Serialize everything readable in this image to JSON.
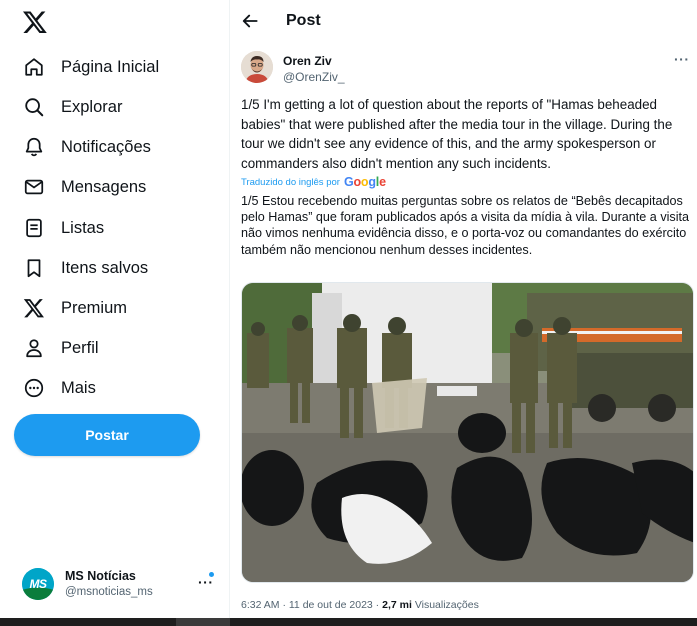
{
  "sidebar": {
    "logo_icon": "x-logo-icon",
    "nav": [
      {
        "label": "Página Inicial",
        "icon": "home-icon"
      },
      {
        "label": "Explorar",
        "icon": "search-icon"
      },
      {
        "label": "Notificações",
        "icon": "bell-icon"
      },
      {
        "label": "Mensagens",
        "icon": "mail-icon"
      },
      {
        "label": "Listas",
        "icon": "list-icon"
      },
      {
        "label": "Itens salvos",
        "icon": "bookmark-icon"
      },
      {
        "label": "Premium",
        "icon": "x-premium-icon"
      },
      {
        "label": "Perfil",
        "icon": "person-icon"
      },
      {
        "label": "Mais",
        "icon": "more-circle-icon"
      }
    ],
    "post_button": "Postar",
    "account": {
      "name": "MS Notícias",
      "handle": "@msnoticias_ms",
      "avatar_text": "MS",
      "more": "···"
    }
  },
  "header": {
    "title": "Post",
    "back_icon": "arrow-left-icon"
  },
  "tweet": {
    "author_name": "Oren Ziv",
    "author_handle": "@OrenZiv_",
    "more": "···",
    "text": "1/5 I'm getting a lot of question about the reports of \"Hamas beheaded babies\" that were published after the media tour in the village. During the tour we didn't see any evidence of this, and the army spokesperson or commanders also didn't mention any such incidents.",
    "translated_by": "Traduzido do inglês por",
    "google": "Google",
    "translation": "1/5 Estou recebendo muitas perguntas sobre os relatos de “Bebês decapitados pelo Hamas” que foram publicados após a visita da mídia à vila. Durante a visita não vimos nenhuma evidência disso, e o porta-voz ou comandantes do exército também não mencionou nenhum desses incidentes.",
    "time": "6:32 AM",
    "date": "11 de out de 2023",
    "views": "2,7 mi",
    "views_label": "Visualizações",
    "separator": " · "
  },
  "colors": {
    "accent": "#1d9bf0",
    "text": "#0f1419",
    "muted": "#536471"
  }
}
